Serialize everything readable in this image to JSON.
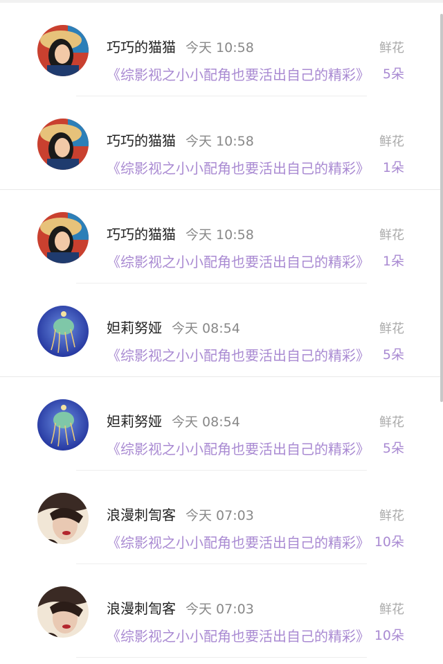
{
  "rows": [
    {
      "name": "巧巧的猫猫",
      "time": "今天 10:58",
      "title": "《综影视之小小配角也要活出自己的精彩》",
      "gift_label": "鲜花",
      "gift_count": "5朵",
      "avatar": "woman-hat-avatar"
    },
    {
      "name": "巧巧的猫猫",
      "time": "今天 10:58",
      "title": "《综影视之小小配角也要活出自己的精彩》",
      "gift_label": "鲜花",
      "gift_count": "1朵",
      "avatar": "woman-hat-avatar"
    },
    {
      "name": "巧巧的猫猫",
      "time": "今天 10:58",
      "title": "《综影视之小小配角也要活出自己的精彩》",
      "gift_label": "鲜花",
      "gift_count": "1朵",
      "avatar": "woman-hat-avatar"
    },
    {
      "name": "妲莉努娅",
      "time": "今天 08:54",
      "title": "《综影视之小小配角也要活出自己的精彩》",
      "gift_label": "鲜花",
      "gift_count": "5朵",
      "avatar": "jellyfish-avatar"
    },
    {
      "name": "妲莉努娅",
      "time": "今天 08:54",
      "title": "《综影视之小小配角也要活出自己的精彩》",
      "gift_label": "鲜花",
      "gift_count": "5朵",
      "avatar": "jellyfish-avatar"
    },
    {
      "name": "浪漫刺訇客",
      "time": "今天 07:03",
      "title": "《综影视之小小配角也要活出自己的精彩》",
      "gift_label": "鲜花",
      "gift_count": "10朵",
      "avatar": "hat-woman-portrait-avatar"
    },
    {
      "name": "浪漫刺訇客",
      "time": "今天 07:03",
      "title": "《综影视之小小配角也要活出自己的精彩》",
      "gift_label": "鲜花",
      "gift_count": "10朵",
      "avatar": "hat-woman-portrait-avatar"
    }
  ],
  "colors": {
    "accent": "#a98ad2",
    "name": "#222222",
    "muted": "#888888"
  }
}
